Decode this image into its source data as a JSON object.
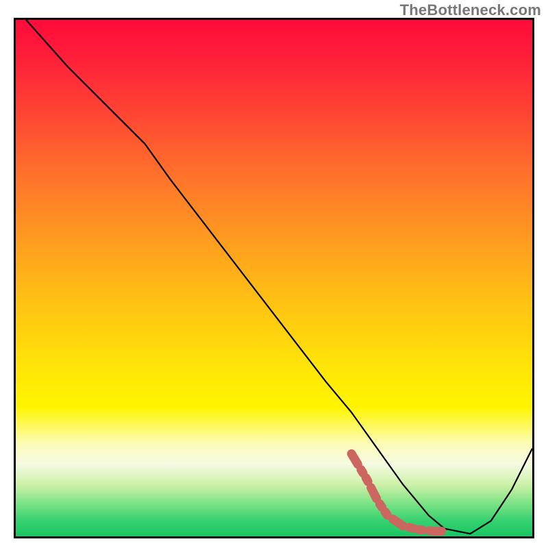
{
  "attribution": "TheBottleneck.com",
  "chart_data": {
    "type": "line",
    "title": "",
    "xlabel": "",
    "ylabel": "",
    "xlim": [
      0,
      100
    ],
    "ylim": [
      0,
      100
    ],
    "grid": false,
    "background": "rainbow-gradient red (top) → green (bottom)",
    "series": [
      {
        "name": "black-curve",
        "color": "#000000",
        "x": [
          2,
          10,
          20,
          25,
          30,
          40,
          50,
          60,
          65,
          70,
          75,
          80,
          83,
          88,
          92,
          96,
          100
        ],
        "values": [
          100,
          91,
          81,
          76,
          69,
          56,
          43,
          30,
          24,
          17,
          10,
          4,
          1.5,
          0.5,
          3,
          9,
          17
        ]
      },
      {
        "name": "red-thick-dashed-segment",
        "color": "#cc6660",
        "style": "thick-dashed",
        "x": [
          65,
          68,
          70,
          72,
          75,
          78,
          81,
          83
        ],
        "values": [
          16,
          11,
          7,
          4,
          2,
          1.3,
          1,
          1
        ]
      }
    ]
  }
}
